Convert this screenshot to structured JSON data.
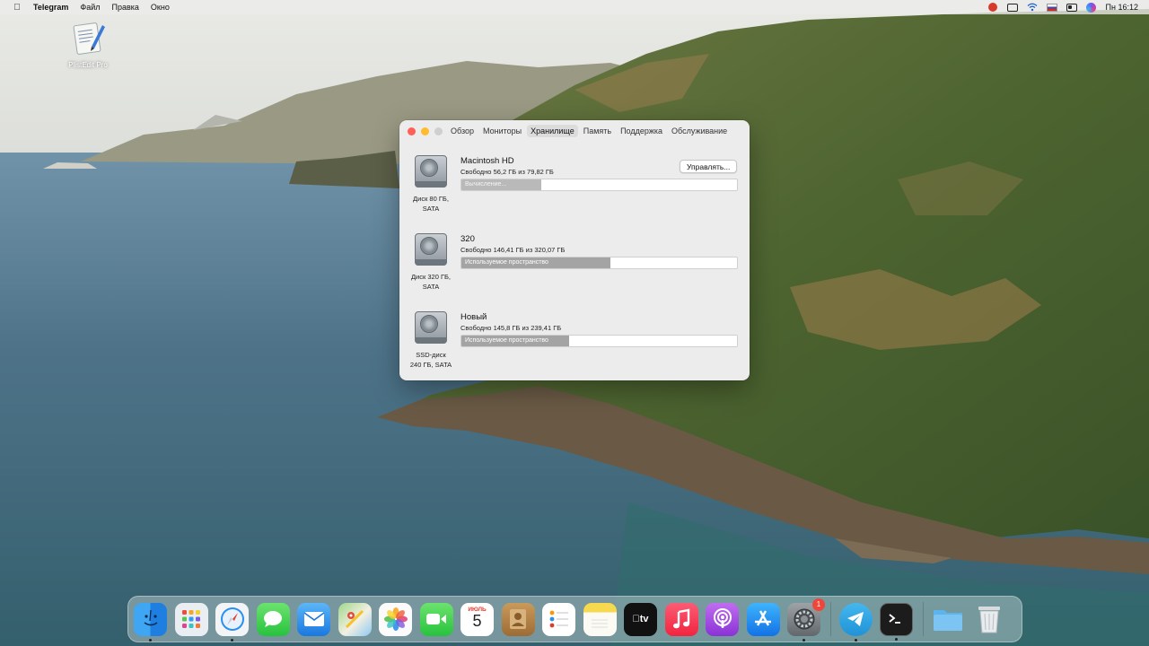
{
  "menubar": {
    "apple": "",
    "app_name": "Telegram",
    "menus": [
      "Файл",
      "Правка",
      "Окно"
    ],
    "status_icons": [
      "antivirus-icon",
      "display-icon",
      "wifi-icon",
      "keyboard-flag-icon",
      "control-center-icon",
      "siri-icon"
    ],
    "clock": "Пн 16:12"
  },
  "desktop": {
    "icon_label": "PlistEdit Pro"
  },
  "window": {
    "tabs": [
      "Обзор",
      "Мониторы",
      "Хранилище",
      "Память",
      "Поддержка",
      "Обслуживание"
    ],
    "active_tab": "Хранилище",
    "drives": [
      {
        "name": "Macintosh HD",
        "free": "Свободно 56,2 ГБ из 79,82 ГБ",
        "caption_line1": "Диск 80 ГБ,",
        "caption_line2": "SATA",
        "bar_text": "Вычисление...",
        "used_fraction": 0.29,
        "manage_label": "Управлять..."
      },
      {
        "name": "320",
        "free": "Свободно 146,41 ГБ из 320,07 ГБ",
        "caption_line1": "Диск 320 ГБ,",
        "caption_line2": "SATA",
        "bar_text": "Используемое пространство",
        "used_fraction": 0.54
      },
      {
        "name": "Новый",
        "free": "Свободно 145,8 ГБ из 239,41 ГБ",
        "caption_line1": "SSD-диск",
        "caption_line2": "240 ГБ, SATA",
        "bar_text": "Используемое пространство",
        "used_fraction": 0.39
      }
    ]
  },
  "dock": {
    "calendar_month": "ИЮЛЬ",
    "calendar_day": "5",
    "settings_badge": "1",
    "apple_tv_label": "tv"
  }
}
